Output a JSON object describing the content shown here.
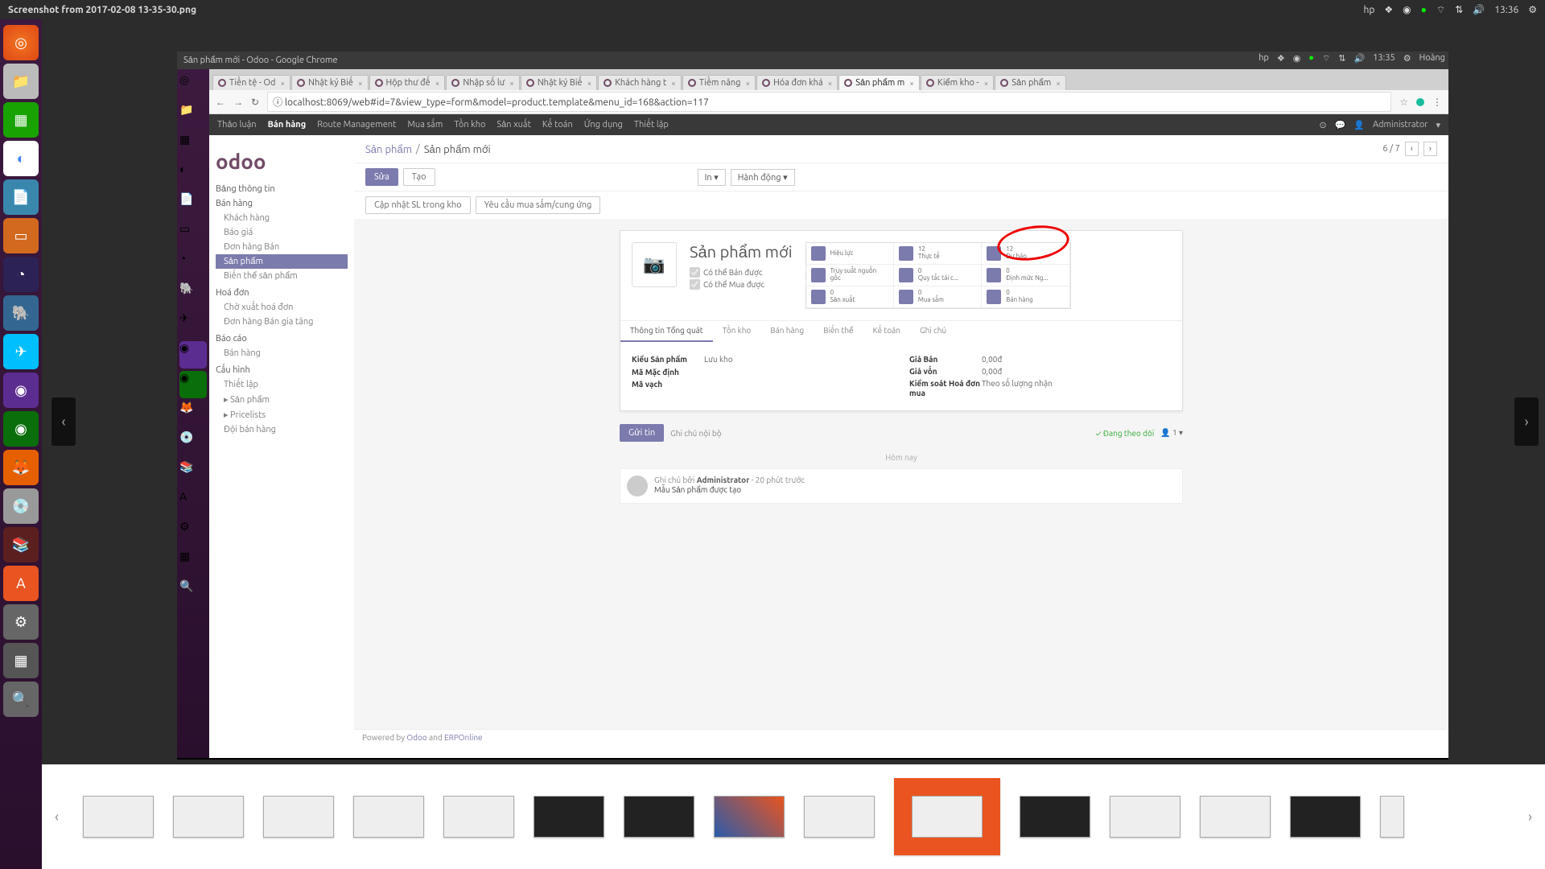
{
  "ubuntu": {
    "title": "Screenshot from 2017-02-08 13-35-30.png",
    "time": "13:36",
    "status_icons": {
      "hp": "hp",
      "dropbox": "❖",
      "chrome": "◉",
      "online": "●",
      "wifi": "⌔",
      "vol": "🔊",
      "gear": "⚙"
    }
  },
  "launcher_apps": [
    "◎",
    "📁",
    "📊",
    "◐",
    "📄",
    "📽",
    "◔",
    "🐘",
    "🐦",
    "●",
    "●",
    "🦊",
    "💿",
    "📚",
    "A",
    "⚙",
    "▦",
    "🔍",
    "🗑"
  ],
  "nav": {
    "left": "‹",
    "right": "›"
  },
  "zoom": {
    "out": "⟲",
    "in": "⟳"
  },
  "chrome_window": {
    "title": "Sản phẩm mới - Odoo - Google Chrome",
    "top_right": {
      "time": "13:35",
      "user": "Hoàng"
    },
    "tabs": [
      {
        "label": "Tiền tệ - Od"
      },
      {
        "label": "Nhật ký Biế"
      },
      {
        "label": "Hộp thư đế"
      },
      {
        "label": "Nhập số lư"
      },
      {
        "label": "Nhật ký Biế"
      },
      {
        "label": "Khách hàng t"
      },
      {
        "label": "Tiềm năng"
      },
      {
        "label": "Hóa đơn khá"
      },
      {
        "label": "Sản phẩm m",
        "active": true
      },
      {
        "label": "Kiểm kho - "
      },
      {
        "label": "Sản phẩm"
      }
    ],
    "addr": {
      "back": "←",
      "fwd": "→",
      "reload": "↻",
      "proto": "ⓘ",
      "url": "localhost:8069/web#id=7&view_type=form&model=product.template&menu_id=168&action=117",
      "star": "☆",
      "menu": "⋮"
    }
  },
  "odoo": {
    "top_menu": [
      "Thảo luận",
      "Bán hàng",
      "Route Management",
      "Mua sắm",
      "Tồn kho",
      "Sản xuất",
      "Kế toán",
      "Ứng dụng",
      "Thiết lập"
    ],
    "top_menu_active": 1,
    "user": "Administrator",
    "logo": "odoo",
    "sidebar": {
      "s1": "Bảng thông tin",
      "s2": "Bán hàng",
      "s2_items": [
        "Khách hàng",
        "Báo giá",
        "Đơn hàng Bán",
        "Sản phẩm",
        "Biến thể sản phẩm"
      ],
      "s2_active": 3,
      "s3": "Hoá đơn",
      "s3_items": [
        "Chờ xuất hoá đơn",
        "Đơn hàng Bán gia tăng"
      ],
      "s4": "Báo cáo",
      "s4_items": [
        "Bán hàng"
      ],
      "s5": "Cấu hình",
      "s5_items": [
        "Thiết lập",
        "Sản phẩm",
        "Pricelists",
        "Đội bán hàng"
      ]
    },
    "breadcrumb": {
      "root": "Sản phẩm",
      "current": "Sản phẩm mới",
      "page": "6 / 7",
      "prev": "‹",
      "next": "›"
    },
    "buttons": {
      "edit": "Sửa",
      "create": "Tạo",
      "print": "In ▾",
      "action": "Hành động ▾"
    },
    "subbuttons": [
      "Cập nhật SL trong kho",
      "Yêu cầu mua sắm/cung ứng"
    ],
    "product": {
      "title": "Sản phẩm mới",
      "can_sell": "Có thể Bán được",
      "can_buy": "Có thể Mua được",
      "img_placeholder": "📷",
      "stats": [
        {
          "n": "",
          "label": "Hiệu lực",
          "icon": "≡"
        },
        {
          "n": "12",
          "label": "Thực tế",
          "icon": "▦"
        },
        {
          "n": "12",
          "label": "Dự báo",
          "icon": "⚗"
        },
        {
          "n": "",
          "label": "Truy suất nguồn gốc",
          "icon": "↕"
        },
        {
          "n": "0",
          "label": "Quy tắc tái c...",
          "icon": "↻"
        },
        {
          "n": "0",
          "label": "Định mức Ng...",
          "icon": "≣"
        },
        {
          "n": "0",
          "label": "Sản xuất",
          "icon": "▦"
        },
        {
          "n": "0",
          "label": "Mua sắm",
          "icon": "🛒"
        },
        {
          "n": "0",
          "label": "Bán hàng",
          "icon": "$"
        }
      ],
      "tabs": [
        "Thông tin Tổng quát",
        "Tồn kho",
        "Bán hàng",
        "Biến thể",
        "Kế toán",
        "Ghi chú"
      ],
      "tabs_active": 0,
      "fields_left": [
        {
          "lbl": "Kiểu Sản phẩm",
          "val": "Lưu kho"
        },
        {
          "lbl": "Mã Mặc định",
          "val": ""
        },
        {
          "lbl": "Mã vạch",
          "val": ""
        }
      ],
      "fields_right": [
        {
          "lbl": "Giá Bán",
          "val": "0,00đ"
        },
        {
          "lbl": "Giá vốn",
          "val": "0,00đ"
        },
        {
          "lbl": "Kiểm soát Hoá đơn mua",
          "val": "Theo số lượng nhận"
        }
      ]
    },
    "chatter": {
      "send": "Gửi tin",
      "note": "Ghi chú nội bộ",
      "following": "✓ Đang theo dõi",
      "followers": "👤 1 ▾",
      "today": "Hôm nay",
      "msg_prefix": "Ghi chú bởi ",
      "msg_author": "Administrator",
      "msg_time": " - 20 phút trước",
      "msg_body": "Mẫu Sản phẩm được tạo"
    },
    "footer": {
      "p1": "Powered by ",
      "odoo": "Odoo",
      "and": " and ",
      "erp": "ERPOnline"
    }
  },
  "thumb_arrows": {
    "left": "‹",
    "right": "›"
  }
}
